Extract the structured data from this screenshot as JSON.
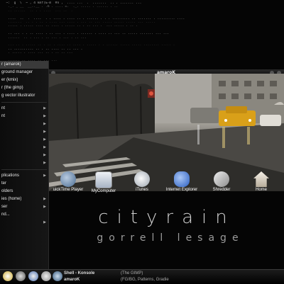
{
  "terminal": {
    "lines": [
      "  ~:  g  \\  ~ ,`4 kmf(&-m  #n ,  .... ...  .  .......  .. . ....... ...   ",
      "   ._. _ __  __..__ . .m . .... =.  ._. ..... . ...... . ..",
      "   .. ......  .. . . ....  ... ..  .",
      "",
      "   ....  ..  .  ....  . . .... . .... .. . ...... . . . ......... .. ....... . ......... ....",
      "   .......  .. . . .. . .... ... .... . ... .. ... ..... ..... ..... ... .....",
      "   ..... . ..... .... .. .... . ..... .. . .. ... .  ... ..... . .. .",
      "",
      "   .. ... . . .. .... . .. ... . .... . ...... . .... .. ... .. ..... ....... ... ...",
      "   ......  .. . ... . .. ... . ... . .. ...",
      "",
      "   ... .. . ..... .. . .. . .... .. .... . ..... . . ...... ..... ..... ........ ..... .",
      "   .. .......... .. . .. .... .. .. ... .",
      "   . ..... . .... ... .. . .. .. ...",
      "",
      "   ...... .. .... .. ... ...",
      "   . .... ...."
    ]
  },
  "window": {
    "title": "amaroK"
  },
  "kmenu": {
    "recent": [
      {
        "label": "r (amarok)",
        "arrow": false
      },
      {
        "label": "ground manager",
        "arrow": false
      },
      {
        "label": "er (kmix)",
        "arrow": false
      },
      {
        "label": "r (the gimp)",
        "arrow": false
      },
      {
        "label": "g vector illustrator",
        "arrow": false
      }
    ],
    "categories": [
      {
        "label": "nt",
        "arrow": true
      },
      {
        "label": "nt",
        "arrow": true
      },
      {
        "label": "",
        "arrow": true
      },
      {
        "label": "",
        "arrow": true
      },
      {
        "label": "",
        "arrow": true
      },
      {
        "label": "",
        "arrow": true
      },
      {
        "label": "",
        "arrow": true
      },
      {
        "label": "",
        "arrow": true
      }
    ],
    "actions": [
      {
        "label": "plications",
        "arrow": true
      },
      {
        "label": "ter",
        "arrow": false
      },
      {
        "label": "olders",
        "arrow": false
      },
      {
        "label": "ies (home)",
        "arrow": true
      },
      {
        "label": "ser",
        "arrow": true
      },
      {
        "label": "nd...",
        "arrow": false
      },
      {
        "label": "",
        "arrow": true
      },
      {
        "label": "",
        "arrow": false
      }
    ]
  },
  "desktop_icons": [
    {
      "label": "uickTime Player",
      "icon": "quicktime-icon",
      "color": "#6f8fb0"
    },
    {
      "label": "MyComputer",
      "icon": "computer-icon",
      "color": "#d8dde6"
    },
    {
      "label": "iTunes",
      "icon": "itunes-icon",
      "color": "#cfd3da"
    },
    {
      "label": "Internet Explorer",
      "icon": "internet-explorer-icon",
      "color": "#4d7fd6"
    },
    {
      "label": "Shredder",
      "icon": "shredder-icon",
      "color": "#c9c9c9"
    },
    {
      "label": "Home",
      "icon": "home-icon",
      "color": "#e8e4dc"
    }
  ],
  "hidden_icon_label": "ments",
  "branding": {
    "title": "cityrain",
    "subtitle": "gorrell lesage"
  },
  "taskbar": {
    "tasks": [
      {
        "label": "Shell - Konsole",
        "bold": true
      },
      {
        "label": "(The GIMP)",
        "bold": false
      },
      {
        "label": "amaroK",
        "bold": true
      },
      {
        "label": "(FG/BG, Patterns, Gradie",
        "bold": false
      }
    ]
  },
  "colors": {
    "background": "#050505",
    "menu_bg": "#121212",
    "taskbar_bg": "#0e0e0e",
    "text": "#e6e6e6"
  }
}
